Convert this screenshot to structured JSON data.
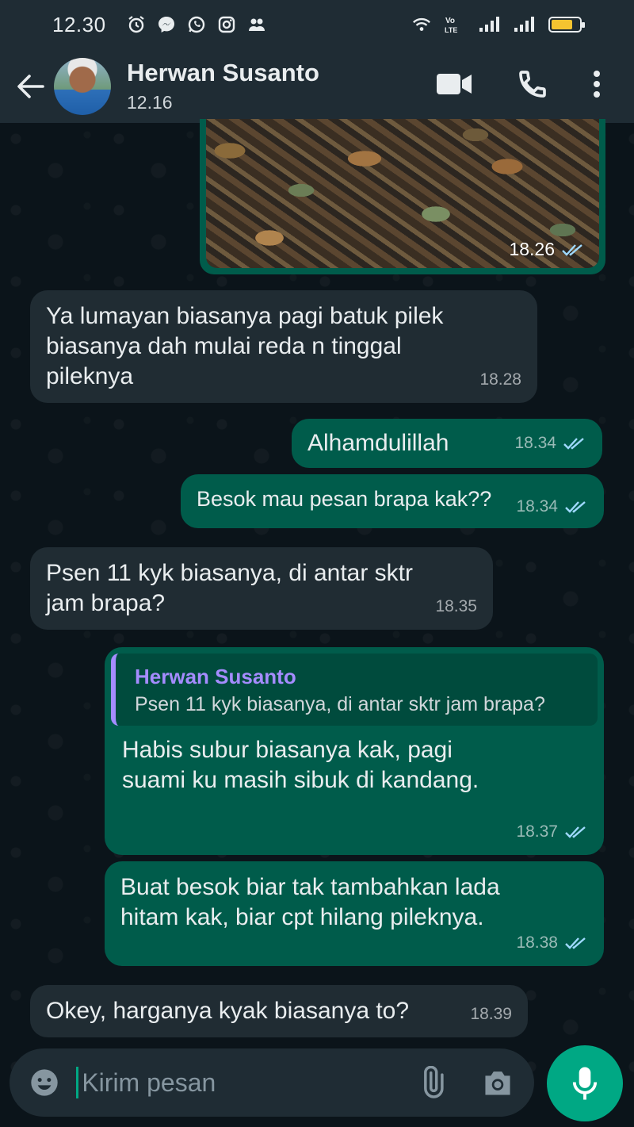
{
  "status_bar": {
    "time": "12.30",
    "network_label": "Vo LTE",
    "battery_level": 0.75
  },
  "header": {
    "contact_name": "Herwan Susanto",
    "contact_status": "12.16",
    "icons": [
      "back-arrow-icon",
      "video-call-icon",
      "voice-call-icon",
      "more-options-icon"
    ]
  },
  "messages": [
    {
      "type": "image",
      "direction": "out",
      "time": "18.26",
      "status": "read"
    },
    {
      "direction": "in",
      "text": "Ya lumayan biasanya pagi batuk pilek biasanya dah mulai reda n tinggal pileknya",
      "time": "18.28"
    },
    {
      "direction": "out",
      "text": "Alhamdulillah",
      "time": "18.34",
      "status": "read"
    },
    {
      "direction": "out",
      "text": "Besok mau pesan brapa kak??",
      "time": "18.34",
      "status": "read"
    },
    {
      "direction": "in",
      "text": "Psen 11 kyk biasanya, di antar sktr jam brapa?",
      "time": "18.35"
    },
    {
      "direction": "out",
      "quote_author": "Herwan Susanto",
      "quote_text": "Psen 11 kyk biasanya, di antar sktr jam brapa?",
      "text": "Habis subur biasanya kak, pagi suami ku masih sibuk di kandang.",
      "time": "18.37",
      "status": "read"
    },
    {
      "direction": "out",
      "text": "Buat besok biar tak tambahkan lada hitam kak, biar cpt hilang pileknya.",
      "time": "18.38",
      "status": "read"
    },
    {
      "direction": "in",
      "text": "Okey, harganya kyak biasanya to?",
      "time": "18.39"
    }
  ],
  "composer": {
    "placeholder": "Kirim pesan"
  },
  "colors": {
    "background": "#0b141a",
    "bar": "#1f2c34",
    "incoming_bubble": "#202c33",
    "outgoing_bubble": "#005c4b",
    "accent": "#00a884",
    "quote_author": "#a58cff"
  }
}
